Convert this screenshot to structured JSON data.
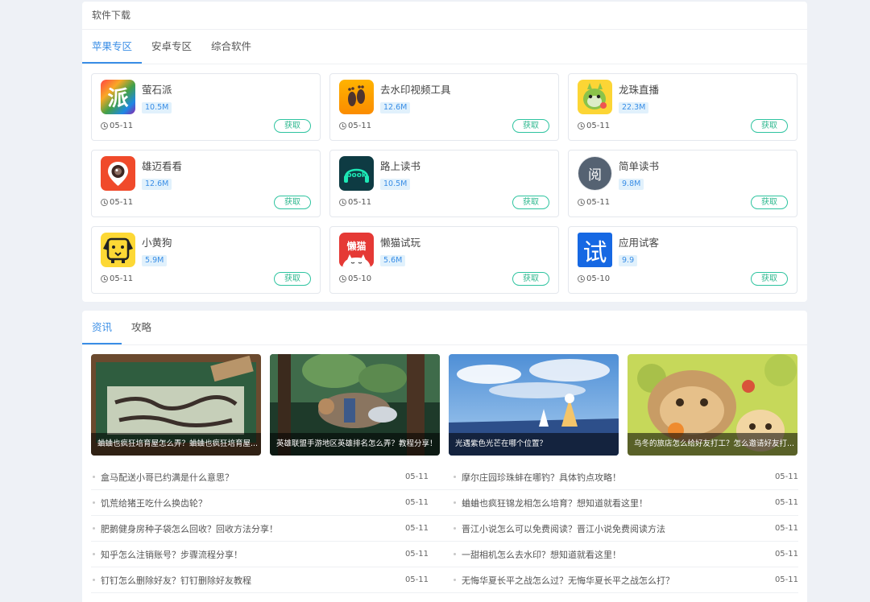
{
  "software": {
    "title": "软件下载",
    "tabs": [
      "苹果专区",
      "安卓专区",
      "综合软件"
    ],
    "apps": [
      {
        "name": "萤石派",
        "size": "10.5M",
        "date": "05-11",
        "button": "获取",
        "icon": "yingshi-pai-icon",
        "icon_text": "派"
      },
      {
        "name": "去水印视频工具",
        "size": "12.6M",
        "date": "05-11",
        "button": "获取",
        "icon": "footprint-icon",
        "icon_text": ""
      },
      {
        "name": "龙珠直播",
        "size": "22.3M",
        "date": "05-11",
        "button": "获取",
        "icon": "dragon-mascot-icon",
        "icon_text": ""
      },
      {
        "name": "雄迈看看",
        "size": "12.6M",
        "date": "05-11",
        "button": "获取",
        "icon": "camera-lens-icon",
        "icon_text": ""
      },
      {
        "name": "路上读书",
        "size": "10.5M",
        "date": "05-11",
        "button": "获取",
        "icon": "book-headphones-icon",
        "icon_text": "book"
      },
      {
        "name": "简单读书",
        "size": "9.8M",
        "date": "05-11",
        "button": "获取",
        "icon": "yue-circle-icon",
        "icon_text": "阅"
      },
      {
        "name": "小黄狗",
        "size": "5.9M",
        "date": "05-11",
        "button": "获取",
        "icon": "yellow-dog-icon",
        "icon_text": ""
      },
      {
        "name": "懒猫试玩",
        "size": "5.6M",
        "date": "05-10",
        "button": "获取",
        "icon": "lazy-cat-icon",
        "icon_text": "懒猫"
      },
      {
        "name": "应用试客",
        "size": "9.9",
        "date": "05-10",
        "button": "获取",
        "icon": "shi-square-icon",
        "icon_text": "试"
      }
    ]
  },
  "news": {
    "tabs": [
      "资讯",
      "攻略"
    ],
    "featured": [
      {
        "caption": "蛐蛐也疯狂培育屋怎么弄？蛐蛐也疯狂培育屋..."
      },
      {
        "caption": "英雄联盟手游地区英雄排名怎么弄？教程分享！"
      },
      {
        "caption": "光遇紫色光芒在哪个位置？"
      },
      {
        "caption": "乌冬的旅店怎么给好友打工？怎么邀请好友打..."
      }
    ],
    "items_left": [
      {
        "title": "盒马配送小哥已约满是什么意思？",
        "date": "05-11"
      },
      {
        "title": "饥荒给猪王吃什么换齿轮？",
        "date": "05-11"
      },
      {
        "title": "肥鹅健身房种子袋怎么回收？回收方法分享！",
        "date": "05-11"
      },
      {
        "title": "知乎怎么注销账号？步骤流程分享！",
        "date": "05-11"
      },
      {
        "title": "钉钉怎么删除好友？钉钉删除好友教程",
        "date": "05-11"
      }
    ],
    "items_right": [
      {
        "title": "摩尔庄园珍珠蚌在哪钓？具体钓点攻略！",
        "date": "05-11"
      },
      {
        "title": "蛐蛐也疯狂锦龙相怎么培育？想知道就看这里！",
        "date": "05-11"
      },
      {
        "title": "晋江小说怎么可以免费阅读？晋江小说免费阅读方法",
        "date": "05-11"
      },
      {
        "title": "一甜相机怎么去水印？想知道就看这里！",
        "date": "05-11"
      },
      {
        "title": "无悔华夏长平之战怎么过？无悔华夏长平之战怎么打？",
        "date": "05-11"
      }
    ]
  }
}
